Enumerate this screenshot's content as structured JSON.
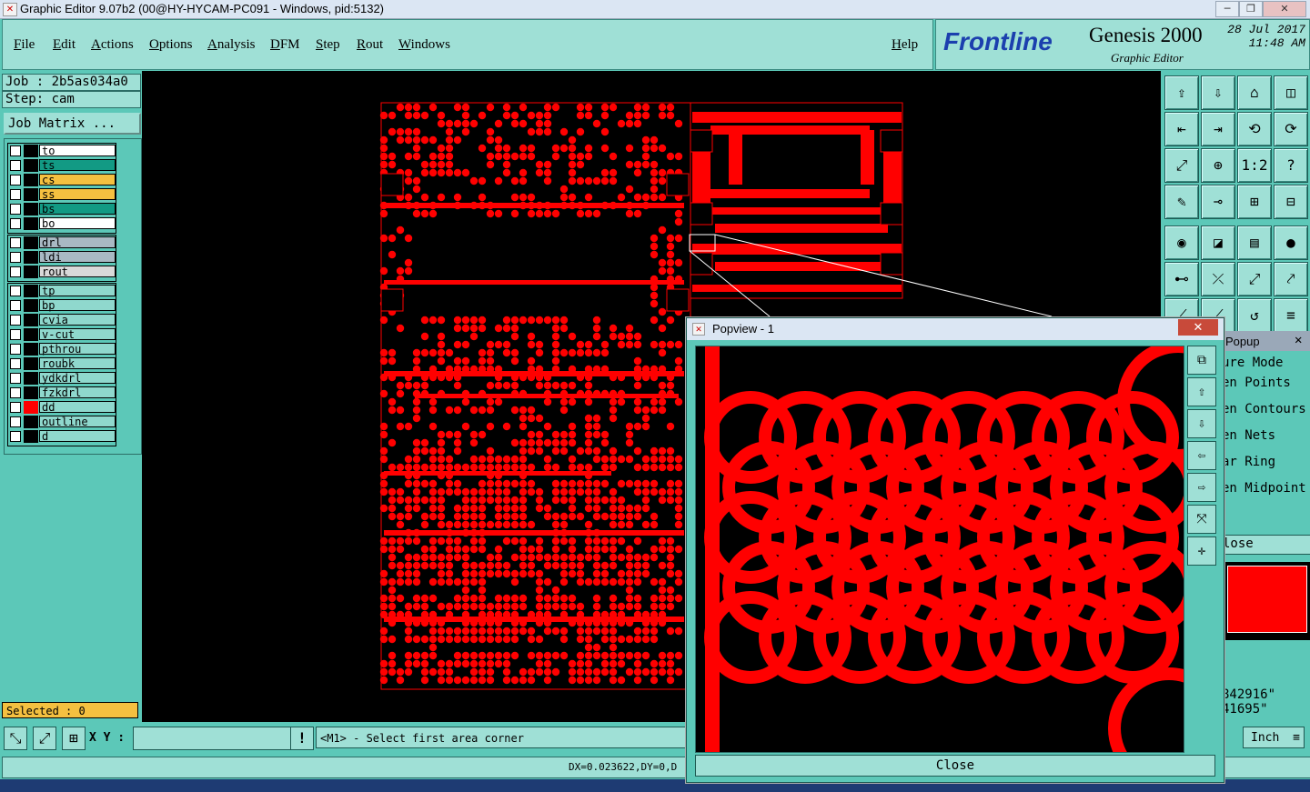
{
  "window": {
    "title": "Graphic Editor 9.07b2 (00@HY-HYCAM-PC091 - Windows, pid:5132)",
    "controls": [
      "─",
      "❐",
      "✕"
    ]
  },
  "menubar": {
    "items": [
      "File",
      "Edit",
      "Actions",
      "Options",
      "Analysis",
      "DFM",
      "Step",
      "Rout",
      "Windows"
    ],
    "help": "Help"
  },
  "logo": {
    "brand": "Frontline",
    "product": "Genesis 2000",
    "subtitle": "Graphic Editor",
    "date": "28 Jul 2017",
    "time": "11:48 AM"
  },
  "job": {
    "job_label": "Job : 2b5as034a0",
    "step_label": "Step: cam",
    "matrix_button": "Job Matrix ..."
  },
  "layers": {
    "group1": [
      {
        "name": "to",
        "bg": "#ffffff",
        "color": "#000000"
      },
      {
        "name": "ts",
        "bg": "#129a84",
        "color": "#000000"
      },
      {
        "name": "cs",
        "bg": "#f5c040",
        "color": "#000000"
      },
      {
        "name": "ss",
        "bg": "#f5c040",
        "color": "#000000"
      },
      {
        "name": "bs",
        "bg": "#129a84",
        "color": "#000000"
      },
      {
        "name": "bo",
        "bg": "#ffffff",
        "color": "#000000"
      }
    ],
    "group2": [
      {
        "name": "drl",
        "bg": "#a9b9c3",
        "color": "#000000"
      },
      {
        "name": "ldi",
        "bg": "#a9b9c3",
        "color": "#000000"
      },
      {
        "name": "rout",
        "bg": "#d9d9d9",
        "color": "#000000"
      }
    ],
    "group3": [
      {
        "name": "tp",
        "bg": "#8fd8cd",
        "color": "#000000"
      },
      {
        "name": "bp",
        "bg": "#8fd8cd",
        "color": "#000000"
      },
      {
        "name": "cvia",
        "bg": "#8fd8cd",
        "color": "#000000"
      },
      {
        "name": "v-cut",
        "bg": "#8fd8cd",
        "color": "#000000"
      },
      {
        "name": "pthrou",
        "bg": "#8fd8cd",
        "color": "#000000"
      },
      {
        "name": "roubk",
        "bg": "#8fd8cd",
        "color": "#000000"
      },
      {
        "name": "ydkdrl",
        "bg": "#8fd8cd",
        "color": "#000000"
      },
      {
        "name": "fzkdrl",
        "bg": "#8fd8cd",
        "color": "#000000"
      },
      {
        "name": "dd",
        "bg": "#8fd8cd",
        "color": "#ff0000"
      },
      {
        "name": "outline",
        "bg": "#8fd8cd",
        "color": "#000000"
      },
      {
        "name": "d",
        "bg": "#8fd8cd",
        "color": "#000000"
      }
    ]
  },
  "selected": "Selected : 0",
  "bottom": {
    "xy_label": "X Y :",
    "xy_value": "",
    "prompt": "<M1> - Select first area corner",
    "unit": "Inch"
  },
  "status": {
    "delta": "DX=0.023622,DY=0,D"
  },
  "popview": {
    "title": "Popview - 1",
    "close_label": "Close"
  },
  "popup": {
    "title": "Popup",
    "items": [
      "ure Mode",
      "en Points",
      "en Contours",
      "en Nets",
      "ar Ring",
      "en Midpoint"
    ],
    "close": "lose",
    "coord1": "842916\"",
    "coord2": "41695\""
  },
  "colors": {
    "panel": "#5cc8b8",
    "panel_light": "#9fe0d6",
    "feature_red": "#ff0000",
    "background": "#000000"
  }
}
